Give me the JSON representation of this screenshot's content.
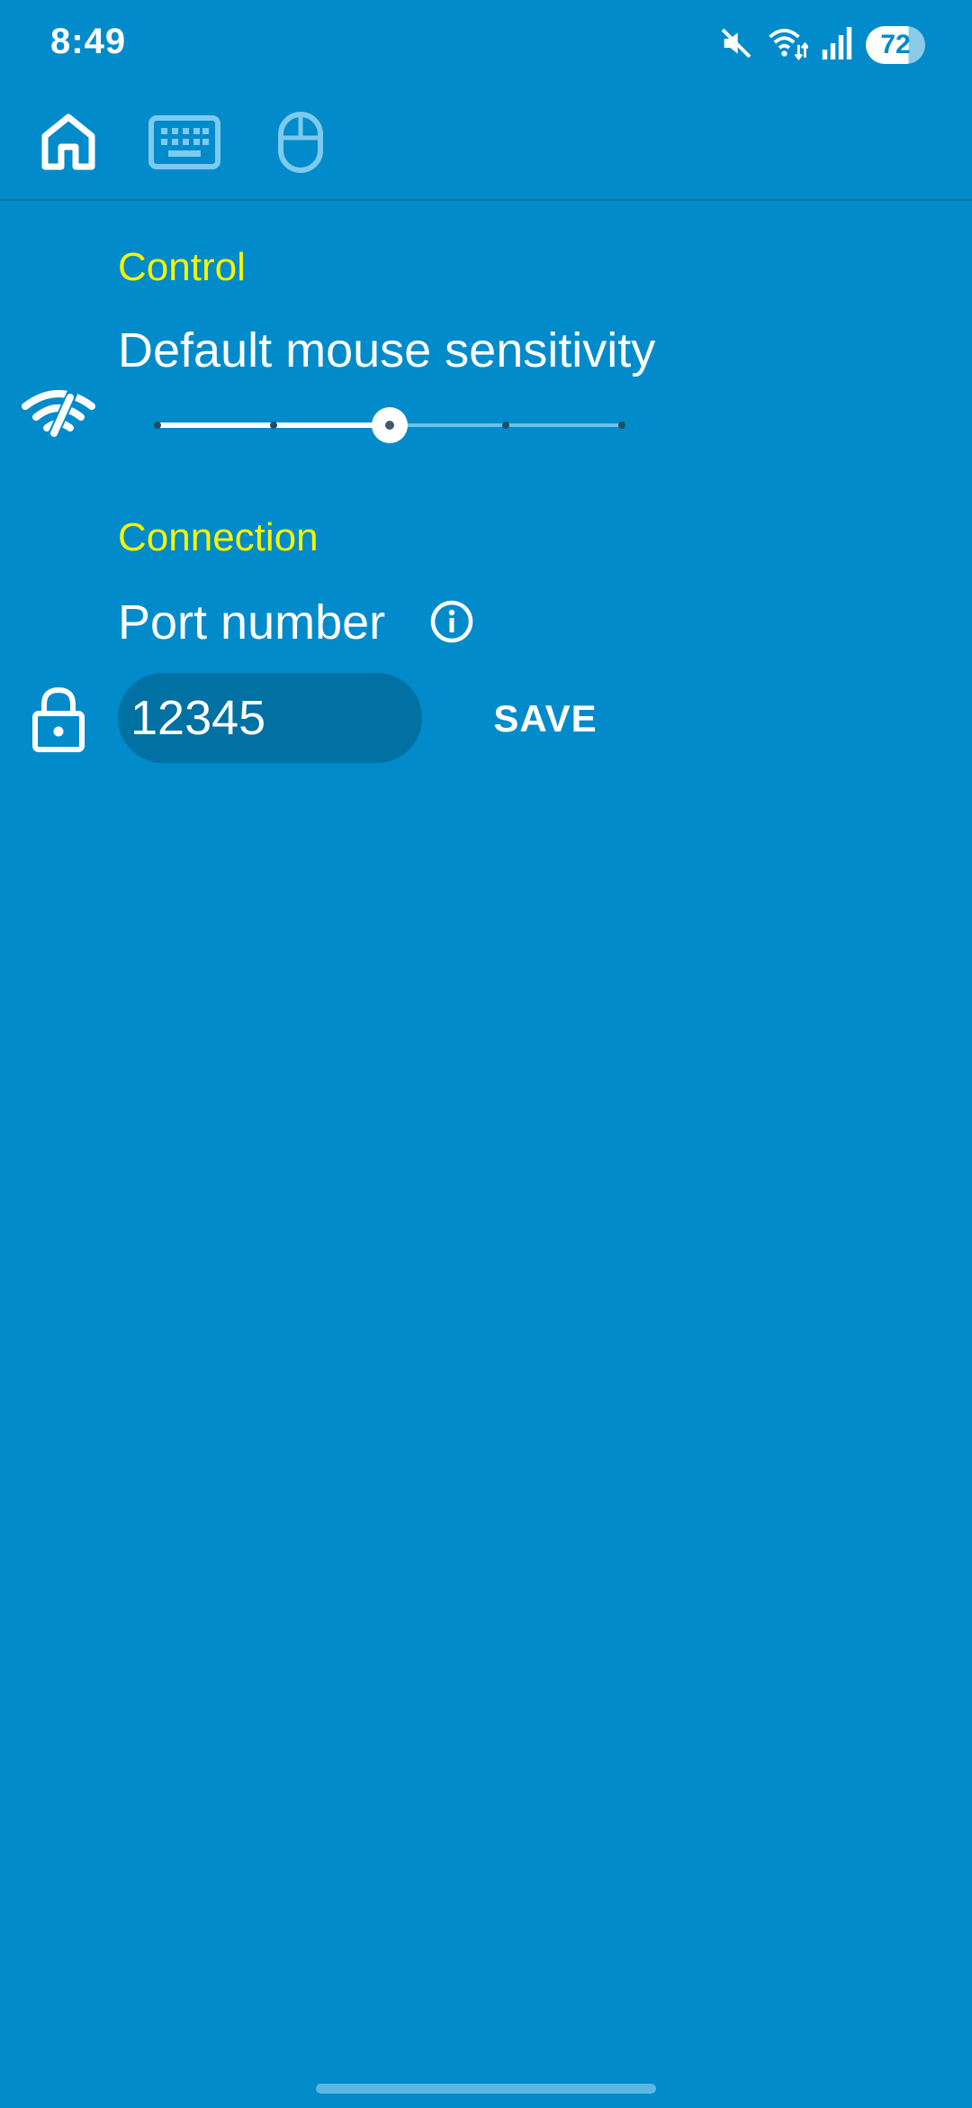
{
  "status_bar": {
    "time": "8:49",
    "battery": "72",
    "icons": [
      "mute-icon",
      "wifi-icon",
      "signal-icon",
      "battery-icon"
    ]
  },
  "tabs": [
    {
      "name": "home",
      "icon": "home-icon",
      "selected": true
    },
    {
      "name": "keyboard",
      "icon": "keyboard-icon",
      "selected": false
    },
    {
      "name": "mouse",
      "icon": "mouse-icon",
      "selected": false
    }
  ],
  "control": {
    "title": "Control",
    "sensitivity_label": "Default mouse sensitivity",
    "side_icon": "wifi-cast-icon",
    "slider": {
      "steps": 5,
      "selected_index": 2
    }
  },
  "connection": {
    "title": "Connection",
    "port_label": "Port number",
    "info_icon": "info-icon",
    "side_icon": "lock-icon",
    "port_value": "12345",
    "save_label": "SAVE"
  },
  "colors": {
    "background": "#018bca",
    "section_title": "#f5f500",
    "text": "#ffffff",
    "input_background": "#0170a3"
  }
}
